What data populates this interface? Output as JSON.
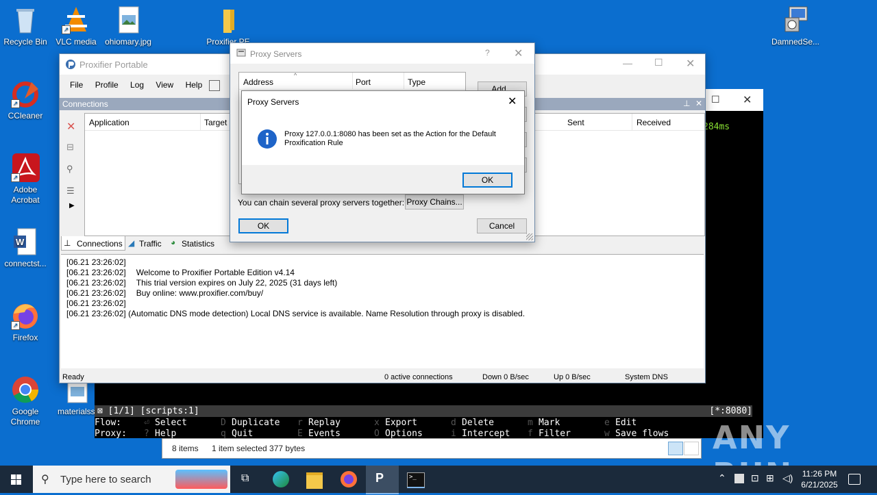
{
  "desktop": {
    "icons": [
      {
        "label": "Recycle Bin"
      },
      {
        "label": "VLC media"
      },
      {
        "label": "ohiomary.jpg"
      },
      {
        "label": "Proxifier PE"
      },
      {
        "label": "DamnedSe..."
      },
      {
        "label": "CCleaner"
      },
      {
        "label": "Adobe Acrobat"
      },
      {
        "label": "connectst..."
      },
      {
        "label": "Firefox"
      },
      {
        "label": "Google Chrome"
      },
      {
        "label": "materialsst"
      }
    ]
  },
  "proxifier": {
    "title": "Proxifier Portable",
    "menu": [
      "File",
      "Profile",
      "Log",
      "View",
      "Help"
    ],
    "connections_panel": "Connections",
    "columns": [
      "Application",
      "Target",
      "Sent",
      "Received"
    ],
    "tabs": [
      "Connections",
      "Traffic",
      "Statistics"
    ],
    "log": [
      {
        "time": "[06.21 23:26:02]",
        "msg": "Welcome to Proxifier Portable Edition v4.14"
      },
      {
        "time": "[06.21 23:26:02]",
        "msg": "This trial version expires on July 22, 2025 (31 days left)"
      },
      {
        "time": "[06.21 23:26:02]",
        "msg": "Buy online: www.proxifier.com/buy/"
      },
      {
        "time": "[06.21 23:26:02]",
        "msg": ""
      },
      {
        "time": "[06.21 23:26:02]",
        "msg": "(Automatic DNS mode detection) Local DNS service is available. Name Resolution through proxy is disabled."
      }
    ],
    "status": {
      "ready": "Ready",
      "active": "0 active connections",
      "down": "Down 0 B/sec",
      "up": "Up 0 B/sec",
      "dns": "System DNS"
    }
  },
  "proxy_servers": {
    "title": "Proxy Servers",
    "help": "?",
    "columns": [
      "Address",
      "Port",
      "Type"
    ],
    "add": "Add...",
    "chain_text": "You can chain several proxy servers together:",
    "chains_button": "Proxy Chains...",
    "ok": "OK",
    "cancel": "Cancel"
  },
  "message_box": {
    "title": "Proxy Servers",
    "message": "Proxy 127.0.0.1:8080 has been set as the Action for the Default Proxification Rule",
    "ok": "OK"
  },
  "terminal": {
    "timing": "284ms",
    "status_left": "[1/1]   [scripts:1]",
    "status_right": "[*:8080]",
    "row1_label": "Flow:",
    "row2_label": "Proxy:",
    "row1": [
      {
        "key": "⏎",
        "action": "Select"
      },
      {
        "key": "D",
        "action": "Duplicate"
      },
      {
        "key": "r",
        "action": "Replay"
      },
      {
        "key": "x",
        "action": "Export"
      },
      {
        "key": "d",
        "action": "Delete"
      },
      {
        "key": "m",
        "action": "Mark"
      },
      {
        "key": "e",
        "action": "Edit"
      }
    ],
    "row2": [
      {
        "key": "?",
        "action": "Help"
      },
      {
        "key": "q",
        "action": "Quit"
      },
      {
        "key": "E",
        "action": "Events"
      },
      {
        "key": "O",
        "action": "Options"
      },
      {
        "key": "i",
        "action": "Intercept"
      },
      {
        "key": "f",
        "action": "Filter"
      },
      {
        "key": "w",
        "action": "Save flows"
      }
    ]
  },
  "explorer_status": {
    "items": "8 items",
    "selected": "1 item selected  377 bytes"
  },
  "taskbar": {
    "search_placeholder": "Type here to search",
    "time": "11:26 PM",
    "date": "6/21/2025"
  },
  "watermark": "ANY RUN"
}
